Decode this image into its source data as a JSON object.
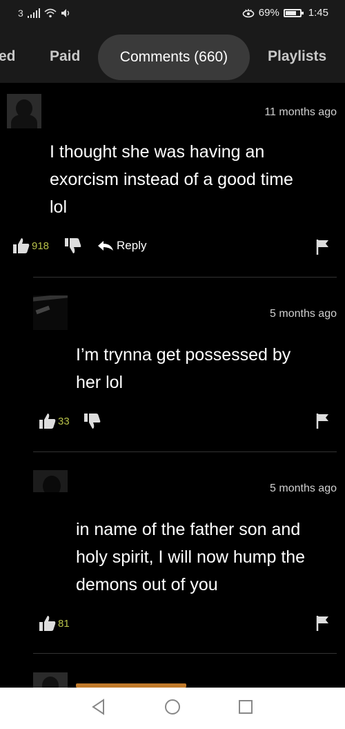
{
  "status_bar": {
    "carrier": "3",
    "battery_percent": "69%",
    "battery_level": 0.69,
    "time": "1:45"
  },
  "tabs": [
    {
      "label": "ed"
    },
    {
      "label": "Paid"
    },
    {
      "label": "Comments (660)"
    },
    {
      "label": "Playlists"
    }
  ],
  "comments": [
    {
      "time": "11 months ago",
      "lines": [
        "I thought she was having an",
        "exorcism instead of a good time",
        "lol"
      ],
      "likes": "918",
      "reply_label": "Reply"
    },
    {
      "time": "5 months ago",
      "lines": [
        "I’m trynna get possessed by",
        "her lol"
      ],
      "likes": "33"
    },
    {
      "time": "5 months ago",
      "lines": [
        "in name of the father son and",
        "holy spirit, I will now hump the",
        "demons out of you"
      ],
      "likes": "81"
    }
  ],
  "colors": {
    "background": "#000000",
    "like_count": "#b8c24a",
    "tab_active_bg": "#3a3a3a"
  }
}
